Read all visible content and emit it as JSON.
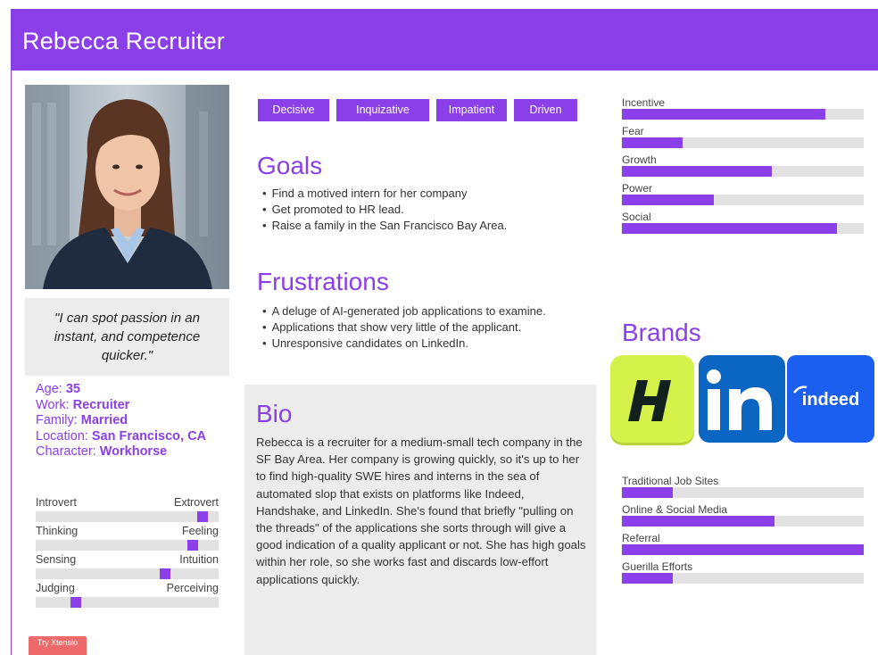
{
  "persona": {
    "name": "Rebecca Recruiter",
    "quote": "\"I can spot passion in an instant, and competence quicker.\""
  },
  "facts": [
    {
      "label": "Age: ",
      "value": "35"
    },
    {
      "label": "Work: ",
      "value": "Recruiter"
    },
    {
      "label": "Family: ",
      "value": "Married"
    },
    {
      "label": "Location: ",
      "value": "San Francisco, CA"
    },
    {
      "label": "Character: ",
      "value": "Workhorse"
    }
  ],
  "personality": [
    {
      "left": "Introvert",
      "right": "Extrovert",
      "value": 0.94
    },
    {
      "left": "Thinking",
      "right": "Feeling",
      "value": 0.88
    },
    {
      "left": "Sensing",
      "right": "Intuition",
      "value": 0.72
    },
    {
      "left": "Judging",
      "right": "Perceiving",
      "value": 0.2
    }
  ],
  "traits": [
    "Decisive",
    "Inquizative",
    "Impatient",
    "Driven"
  ],
  "goals": {
    "title": "Goals",
    "items": [
      "Find a motived intern for her company",
      "Get promoted to HR lead.",
      "Raise a family in the San Francisco Bay Area."
    ]
  },
  "frustrations": {
    "title": "Frustrations",
    "items": [
      "A deluge of AI-generated job applications to examine.",
      "Applications that show very little of the applicant.",
      "Unresponsive candidates on LinkedIn."
    ]
  },
  "bio": {
    "title": "Bio",
    "text": "Rebecca is a recruiter for a medium-small tech company in the SF Bay Area. Her company is growing quickly, so it's up to her to find high-quality SWE hires and interns in the sea of automated slop that exists on platforms like Indeed, Handshake, and LinkedIn. She's found that briefly \"pulling on the threads\" of the applications she sorts through will give a good indication of a quality applicant or not. She has high goals within her role, so she works fast and discards low-effort applications quickly."
  },
  "motivations": [
    {
      "label": "Incentive",
      "value": 0.84
    },
    {
      "label": "Fear",
      "value": 0.25
    },
    {
      "label": "Growth",
      "value": 0.62
    },
    {
      "label": "Power",
      "value": 0.38
    },
    {
      "label": "Social",
      "value": 0.89
    }
  ],
  "brands": {
    "title": "Brands",
    "items": [
      {
        "name": "Handshake",
        "glyph": "H",
        "color": "#d4f24a"
      },
      {
        "name": "LinkedIn",
        "glyph": "in",
        "color": "#0a66c2"
      },
      {
        "name": "Indeed",
        "glyph": "indeed",
        "color": "#1a5ff0"
      }
    ]
  },
  "channels": [
    {
      "label": "Traditional Job Sites",
      "value": 0.21
    },
    {
      "label": "Online & Social Media",
      "value": 0.63
    },
    {
      "label": "Referral",
      "value": 1.0
    },
    {
      "label": "Guerilla Efforts",
      "value": 0.21
    }
  ],
  "badge": {
    "text": "Try Xtensio"
  },
  "colors": {
    "accent": "#8a3fe8",
    "panel": "#ececec",
    "track": "#e2e2e2",
    "badge": "#ee6a6a"
  }
}
